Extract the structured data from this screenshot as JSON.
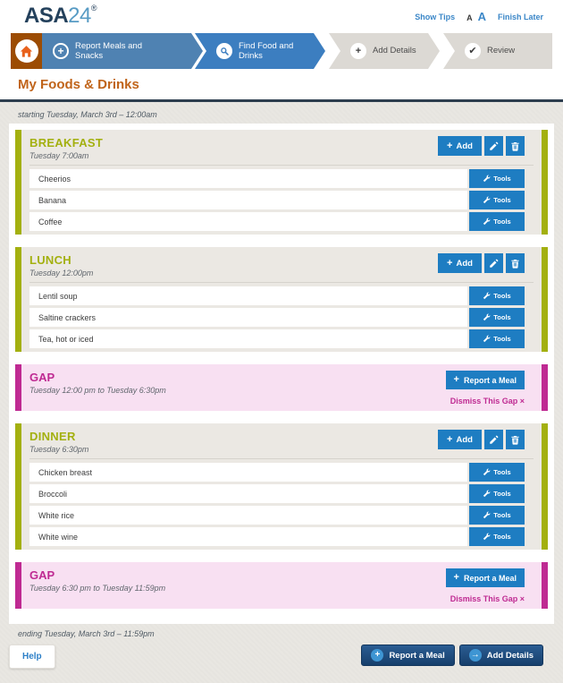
{
  "header": {
    "logo_primary": "ASA",
    "logo_secondary": "24",
    "logo_mark": "®",
    "show_tips": "Show Tips",
    "font_size_small": "A",
    "font_size_large": "A",
    "finish_later": "Finish Later"
  },
  "wizard": {
    "steps": [
      {
        "label": "Report Meals and Snacks",
        "icon": "plus-circle-icon",
        "state": "completed"
      },
      {
        "label": "Find Food and Drinks",
        "icon": "search-icon",
        "state": "active"
      },
      {
        "label": "Add Details",
        "icon": "plus-icon",
        "state": "upcoming"
      },
      {
        "label": "Review",
        "icon": "check-icon",
        "state": "upcoming"
      }
    ]
  },
  "page_title": "My Foods & Drinks",
  "timeline": {
    "starting": "starting Tuesday, March 3rd – 12:00am",
    "ending": "ending Tuesday, March 3rd – 11:59pm"
  },
  "sections": [
    {
      "type": "meal",
      "title": "BREAKFAST",
      "time": "Tuesday 7:00am",
      "items": [
        "Cheerios",
        "Banana",
        "Coffee"
      ]
    },
    {
      "type": "meal",
      "title": "LUNCH",
      "time": "Tuesday 12:00pm",
      "items": [
        "Lentil soup",
        "Saltine crackers",
        "Tea, hot or iced"
      ]
    },
    {
      "type": "gap",
      "title": "GAP",
      "range": "Tuesday 12:00 pm to Tuesday 6:30pm"
    },
    {
      "type": "meal",
      "title": "DINNER",
      "time": "Tuesday 6:30pm",
      "items": [
        "Chicken breast",
        "Broccoli",
        "White rice",
        "White wine"
      ]
    },
    {
      "type": "gap",
      "title": "GAP",
      "range": "Tuesday 6:30 pm to Tuesday 11:59pm"
    }
  ],
  "labels": {
    "add": "Add",
    "tools": "Tools",
    "report_a_meal": "Report a Meal",
    "dismiss_gap": "Dismiss This Gap ×",
    "help": "Help",
    "add_details": "Add Details"
  },
  "colors": {
    "accent_blue": "#1e7dc2",
    "olive": "#a3b00f",
    "magenta": "#bf2a92",
    "gap_bg": "#f8e0f2",
    "navy_button": "#1c4b7e",
    "link_blue": "#3b87c8",
    "title_orange": "#c0641a",
    "logo_navy": "#24415c",
    "logo_blue": "#579bc4",
    "step_blue_done": "#4f82b2",
    "step_blue_active": "#3c7ec0",
    "step_gray": "#dcd9d4",
    "home_box_orange": "#9c4c03",
    "house_orange": "#e8611c",
    "navy_divider": "#2d3e4e",
    "content_bg": "#e9e7e2",
    "panel_bg": "#ebe8e3"
  }
}
